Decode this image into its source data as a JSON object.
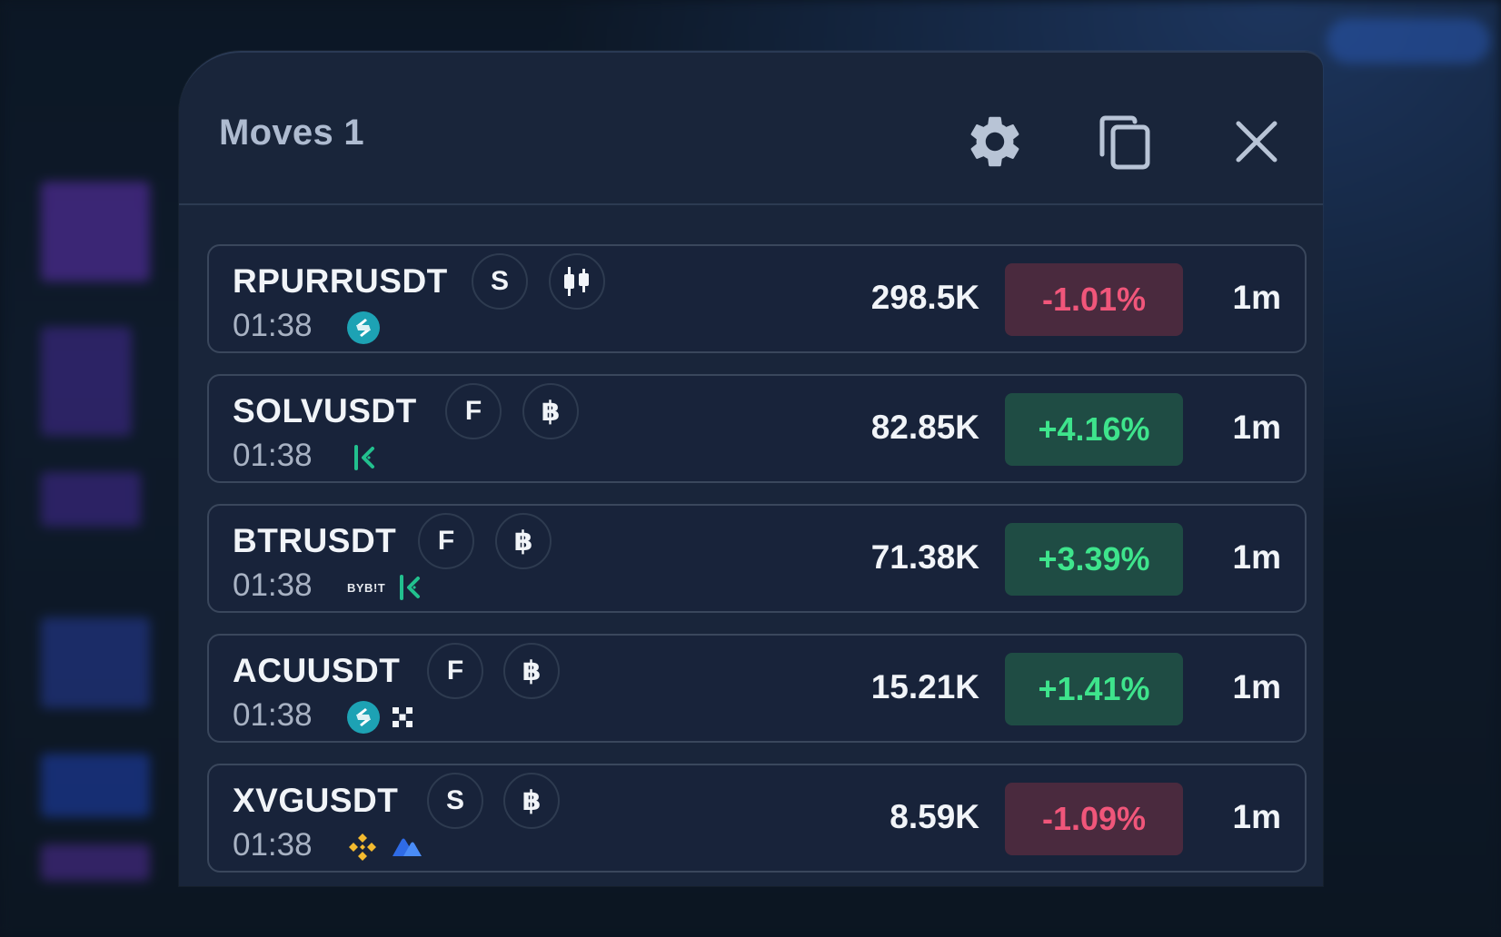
{
  "panel": {
    "title": "Moves 1",
    "settings_icon": "gear-icon",
    "copy_icon": "copy-icon",
    "close_icon": "close-icon"
  },
  "colors": {
    "negative_text": "#f0567a",
    "negative_bg": "#4a2a3e",
    "positive_text": "#3ee48c",
    "positive_bg": "#1f4c44",
    "panel_bg": "#19253a"
  },
  "rows": [
    {
      "symbol": "RPURRUSDT",
      "market": "S",
      "asset_icon": "candlestick-icon",
      "time": "01:38",
      "exchanges": [
        "bitget-icon"
      ],
      "volume": "298.5K",
      "change": "-1.01%",
      "direction": "negative",
      "timeframe": "1m"
    },
    {
      "symbol": "SOLVUSDT",
      "market": "F",
      "asset_icon": "bitcoin-icon",
      "time": "01:38",
      "exchanges": [
        "kucoin-icon"
      ],
      "volume": "82.85K",
      "change": "+4.16%",
      "direction": "positive",
      "timeframe": "1m"
    },
    {
      "symbol": "BTRUSDT",
      "market": "F",
      "asset_icon": "bitcoin-icon",
      "time": "01:38",
      "exchanges": [
        "bybit-logo",
        "kucoin-icon"
      ],
      "bybit_label": "BYB!T",
      "volume": "71.38K",
      "change": "+3.39%",
      "direction": "positive",
      "timeframe": "1m"
    },
    {
      "symbol": "ACUUSDT",
      "market": "F",
      "asset_icon": "bitcoin-icon",
      "time": "01:38",
      "exchanges": [
        "bitget-icon",
        "okx-icon"
      ],
      "volume": "15.21K",
      "change": "+1.41%",
      "direction": "positive",
      "timeframe": "1m"
    },
    {
      "symbol": "XVGUSDT",
      "market": "S",
      "asset_icon": "bitcoin-icon",
      "time": "01:38",
      "exchanges": [
        "binance-icon",
        "mexc-icon"
      ],
      "volume": "8.59K",
      "change": "-1.09%",
      "direction": "negative",
      "timeframe": "1m"
    }
  ]
}
